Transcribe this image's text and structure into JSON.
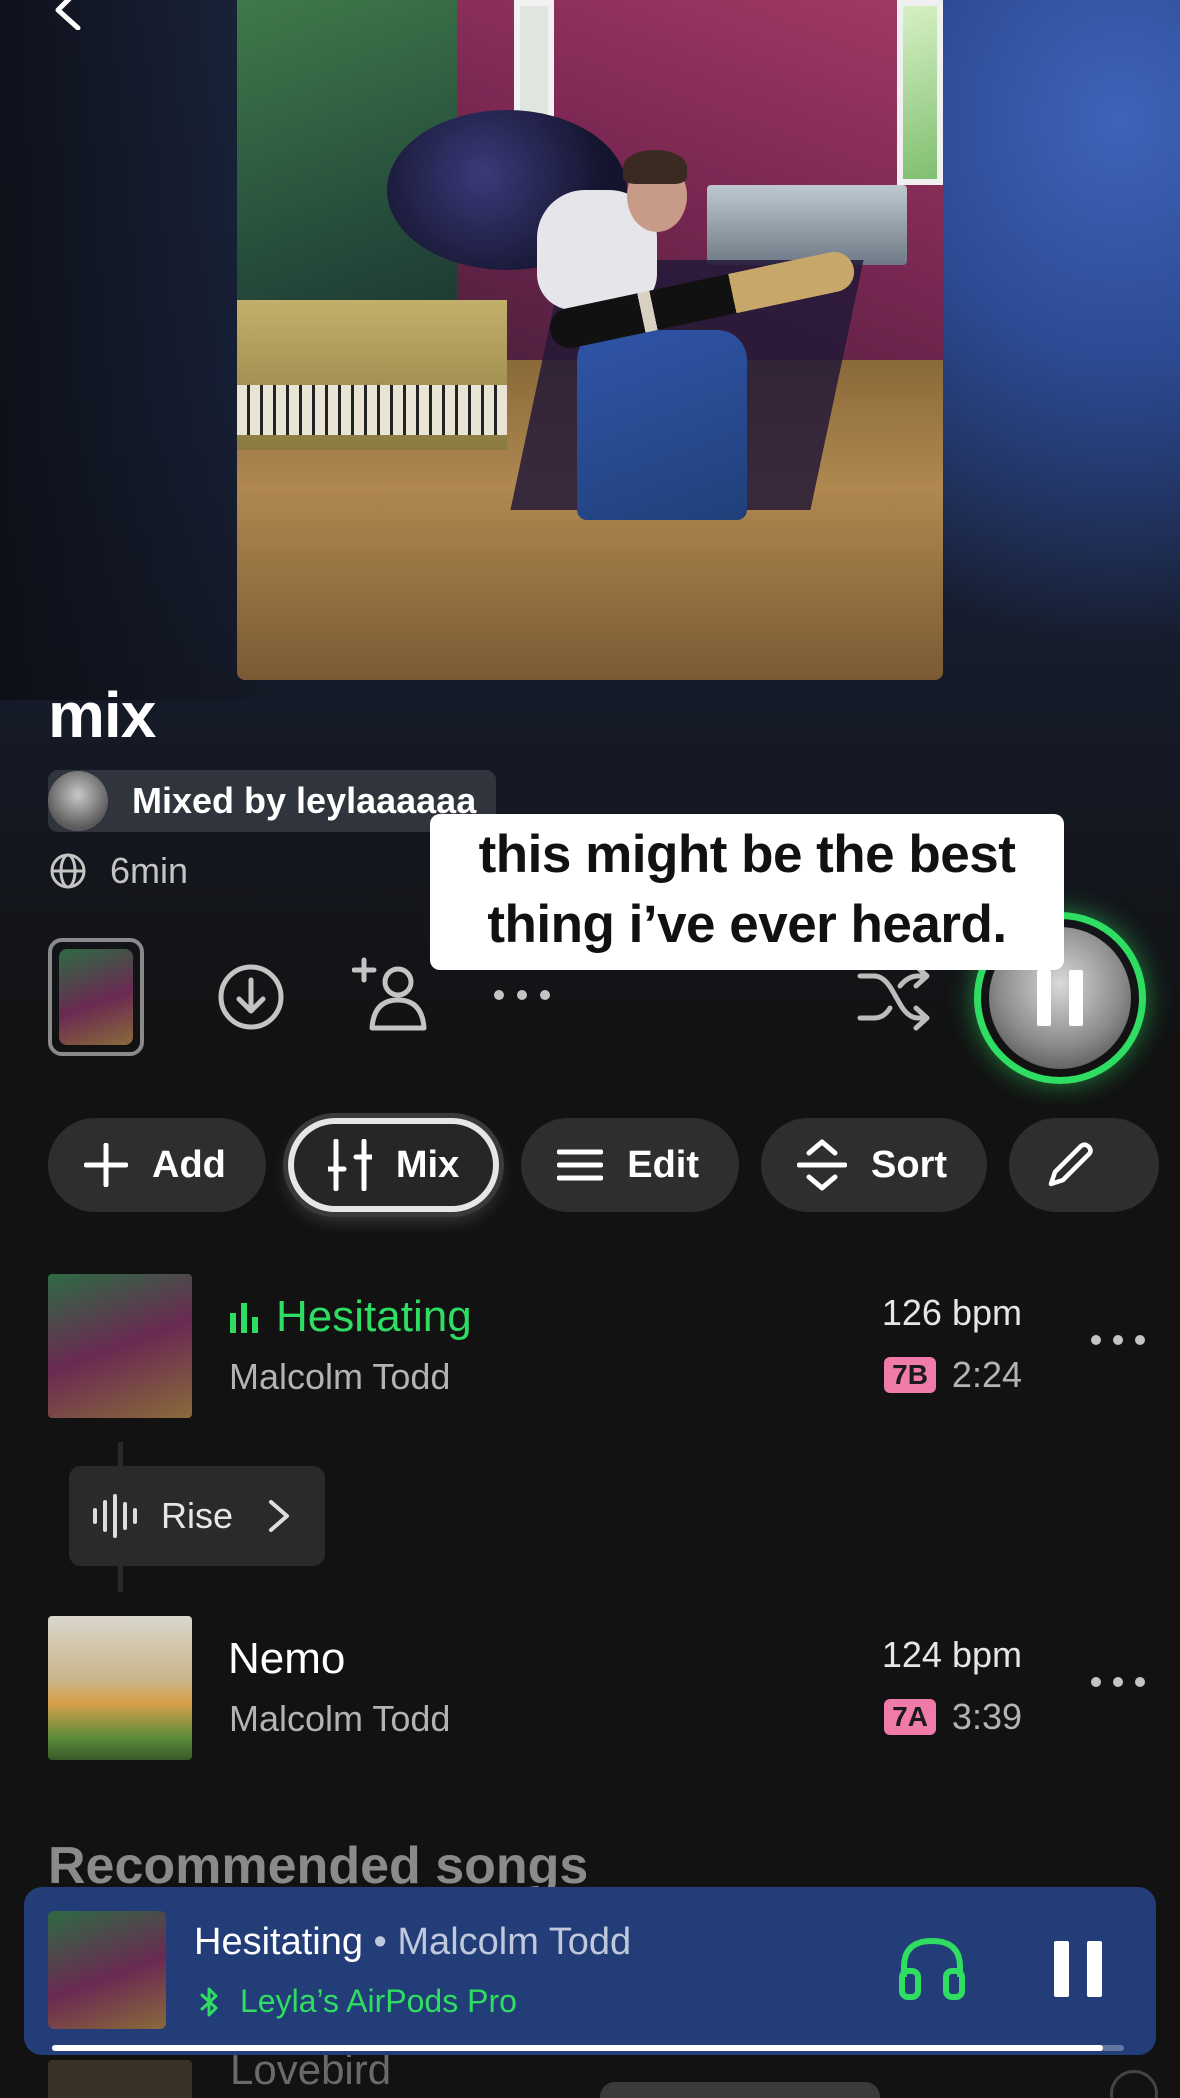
{
  "playlist": {
    "title": "mix",
    "mixed_by": "Mixed by leylaaaaaa",
    "duration": "6min"
  },
  "caption": {
    "line1": "this might be the best",
    "line2": "thing i’ve ever heard."
  },
  "actions": {
    "icons": [
      "chevron-left-icon",
      "download-icon",
      "add-collaborator-icon",
      "more-horizontal-icon",
      "shuffle-icon",
      "pause-icon"
    ]
  },
  "chips": [
    {
      "label": "Add",
      "icon": "plus-icon"
    },
    {
      "label": "Mix",
      "icon": "mixer-sliders-icon",
      "active": true
    },
    {
      "label": "Edit",
      "icon": "list-icon"
    },
    {
      "label": "Sort",
      "icon": "sort-arrows-icon"
    },
    {
      "label": "",
      "icon": "pencil-icon"
    }
  ],
  "tracks": [
    {
      "name": "Hesitating",
      "artist": "Malcolm Todd",
      "bpm": "126 bpm",
      "key": "7B",
      "length": "2:24",
      "playing": true
    },
    {
      "name": "Nemo",
      "artist": "Malcolm Todd",
      "bpm": "124 bpm",
      "key": "7A",
      "length": "3:39",
      "playing": false
    }
  ],
  "transition": {
    "label": "Rise"
  },
  "recommended": {
    "title": "Recommended songs",
    "first_song": "Lovebird"
  },
  "now_playing": {
    "song": "Hesitating",
    "separator": " • ",
    "artist": "Malcolm Todd",
    "device": "Leyla’s AirPods Pro",
    "progress": 0.98
  },
  "colors": {
    "accent_green": "#2edd62",
    "key_badge": "#f07aa8",
    "now_playing_bg": "#223d78",
    "background": "#121212"
  }
}
